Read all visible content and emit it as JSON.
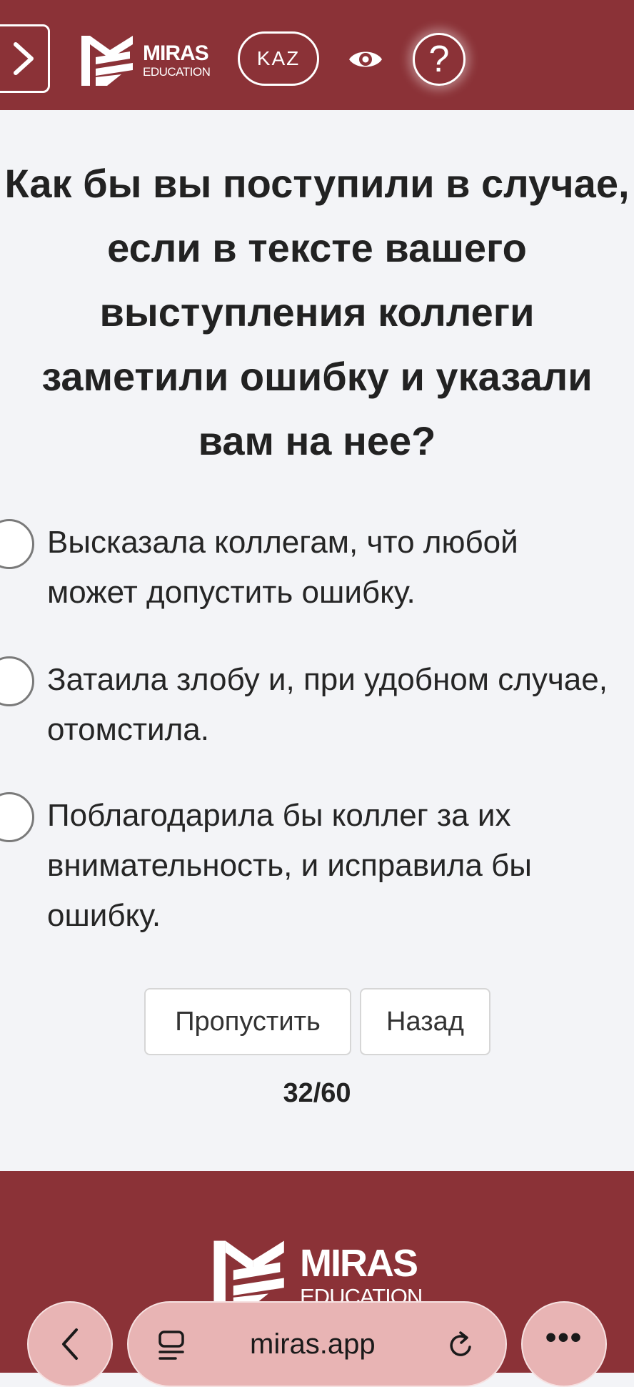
{
  "header": {
    "logo_word": "MIRAS",
    "logo_sub": "EDUCATION",
    "language": "KAZ",
    "help_label": "?",
    "icons": [
      "chevron-right-icon",
      "eye-icon",
      "question-icon"
    ]
  },
  "question": {
    "text": "Как бы вы поступили в случае,\nесли в тексте вашего\nвыступления коллеги\nзаметили ошибку и указали\nвам на нее?"
  },
  "options": [
    {
      "text": "Высказала коллегам, что любой\nможет допустить ошибку.",
      "selected": false
    },
    {
      "text": "Затаила злобу и, при удобном случае,\nотомстила.",
      "selected": false
    },
    {
      "text": "Поблагодарила бы коллег за их\nвнимательность, и исправила бы\nошибку.",
      "selected": false
    }
  ],
  "actions": {
    "skip_label": "Пропустить",
    "back_label": "Назад"
  },
  "progress": {
    "counter_text": "32/60",
    "current": 32,
    "total": 60
  },
  "footer": {
    "logo_word": "MIRAS",
    "logo_sub": "EDUCATION"
  },
  "browser": {
    "url": "miras.app",
    "icons": [
      "chevron-left-icon",
      "reader-icon",
      "reload-icon",
      "more-icon"
    ]
  },
  "colors": {
    "brand": "#8b3237",
    "background": "#f3f4f7",
    "browser_bar": "#e8b4b4"
  }
}
